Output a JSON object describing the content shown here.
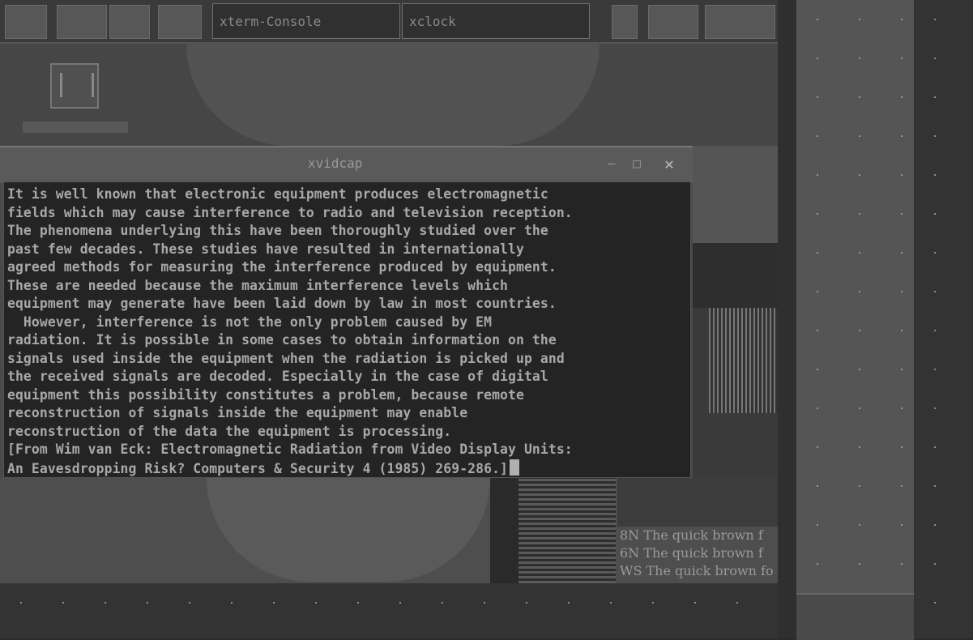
{
  "taskbar": {
    "buttons": [
      "xterm-Console",
      "xclock"
    ]
  },
  "window": {
    "title": "xvidcap"
  },
  "terminal": {
    "lines": [
      "It is well known that electronic equipment produces electromagnetic",
      "fields which may cause interference to radio and television reception.",
      "The phenomena underlying this have been thoroughly studied over the",
      "past few decades. These studies have resulted in internationally",
      "agreed methods for measuring the interference produced by equipment.",
      "These are needed because the maximum interference levels which",
      "equipment may generate have been laid down by law in most countries.",
      "  However, interference is not the only problem caused by EM",
      "radiation. It is possible in some cases to obtain information on the",
      "signals used inside the equipment when the radiation is picked up and",
      "the received signals are decoded. Especially in the case of digital",
      "equipment this possibility constitutes a problem, because remote",
      "reconstruction of signals inside the equipment may enable",
      "reconstruction of the data the equipment is processing.",
      "[From Wim van Eck: Electromagnetic Radiation from Video Display Units:",
      "An Eavesdropping Risk? Computers & Security 4 (1985) 269-286.]"
    ]
  },
  "font_preview": {
    "lines": [
      "8N The quick brown f",
      "6N The quick brown f",
      "WS The quick brown fo"
    ]
  }
}
